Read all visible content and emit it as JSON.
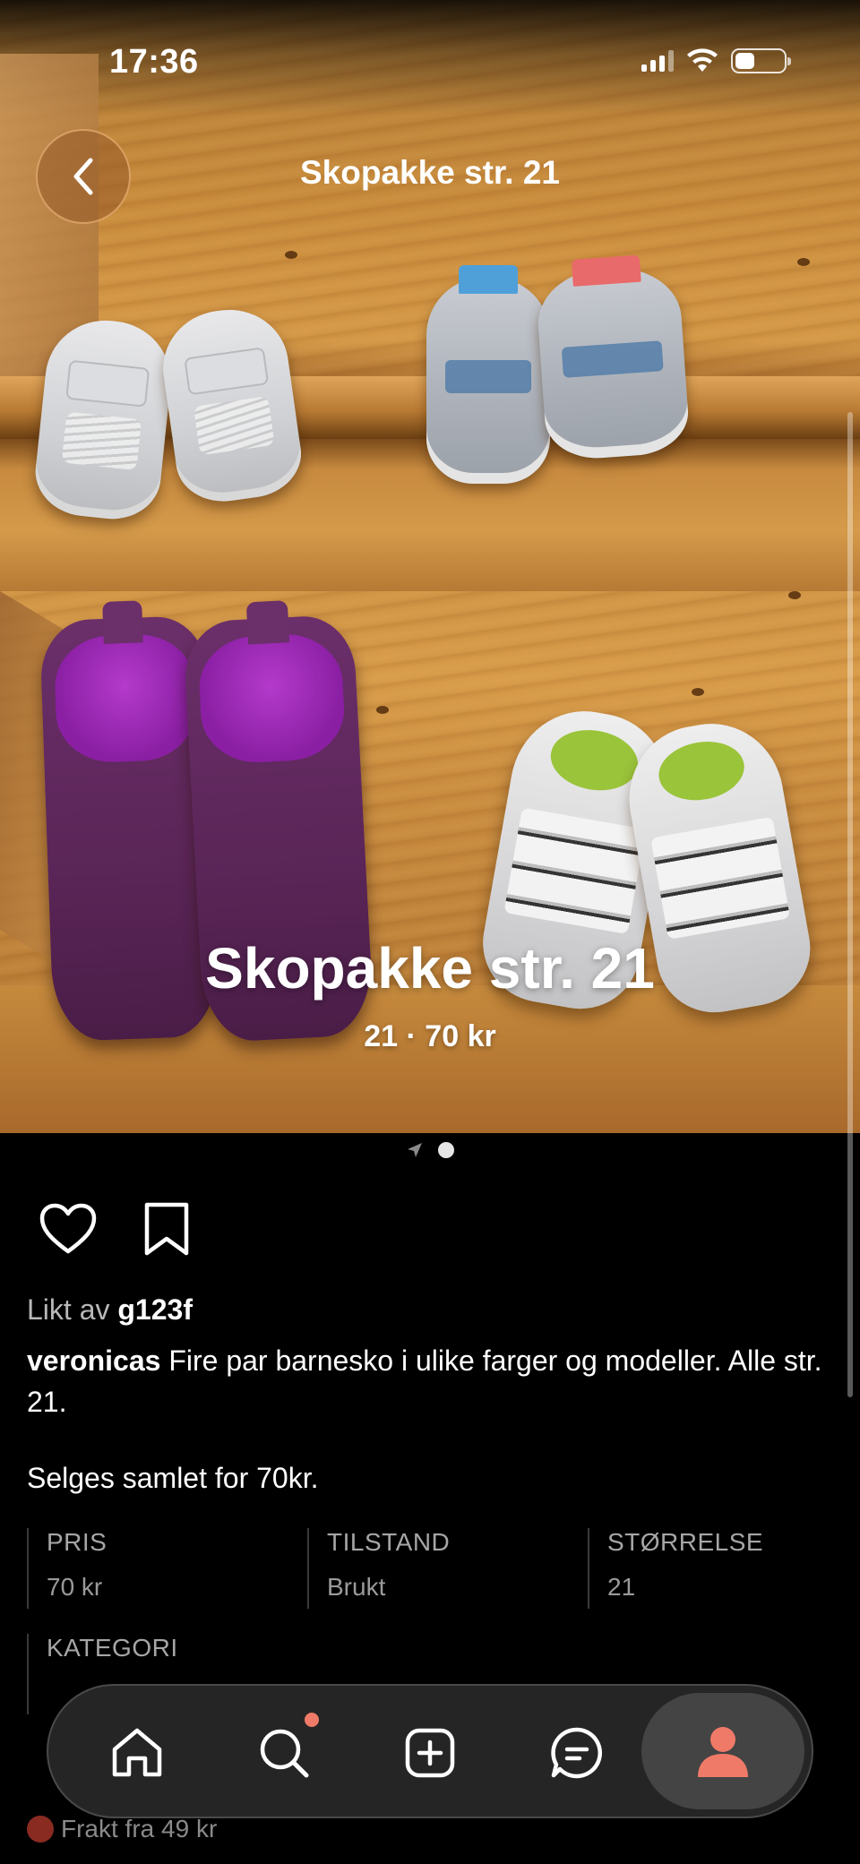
{
  "status": {
    "time": "17:36"
  },
  "header": {
    "title": "Skopakke str. 21"
  },
  "photo": {
    "overlay_title": "Skopakke str. 21",
    "overlay_subtitle": "21 · 70 kr"
  },
  "social": {
    "liked_prefix": "Likt av",
    "liked_user": "g123f"
  },
  "description": {
    "author": "veronicas",
    "text": "Fire par barnesko i ulike farger og modeller. Alle str. 21.",
    "extra": "Selges samlet for 70kr."
  },
  "details": [
    {
      "label": "PRIS",
      "value": "70 kr"
    },
    {
      "label": "TILSTAND",
      "value": "Brukt"
    },
    {
      "label": "STØRRELSE",
      "value": "21"
    },
    {
      "label": "KATEGORI",
      "value": ""
    }
  ],
  "shipping": {
    "label": "Frakt fra 49 kr"
  },
  "colors": {
    "accent": "#f07a68",
    "background": "#000000"
  },
  "nav": {
    "items": [
      "home-icon",
      "search-icon",
      "add-icon",
      "messages-icon",
      "profile-icon"
    ],
    "active": "profile-icon"
  }
}
